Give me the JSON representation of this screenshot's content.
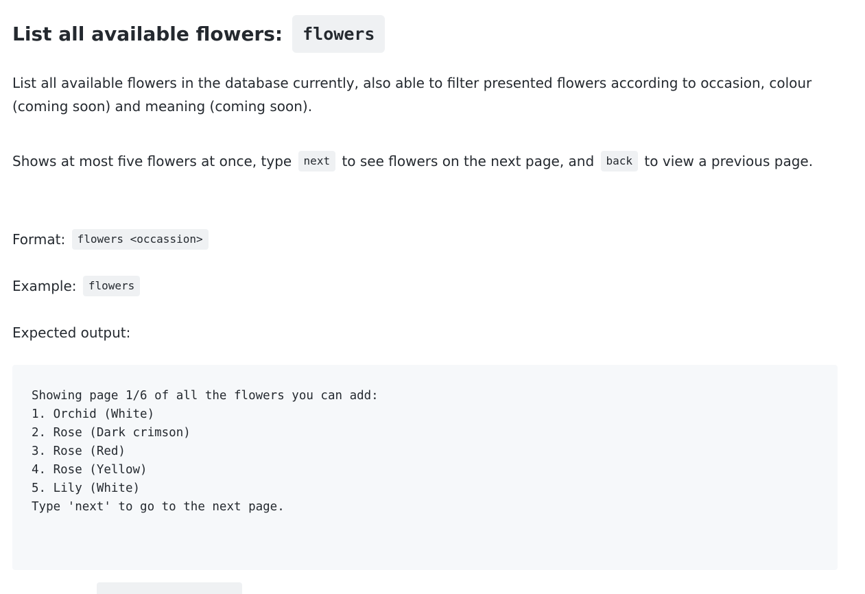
{
  "heading": {
    "text": "List all available flowers:",
    "code": "flowers"
  },
  "description": "List all available flowers in the database currently, also able to filter presented flowers according to occasion, colour (coming soon) and meaning (coming soon).",
  "paging": {
    "before_next": "Shows at most five flowers at once, type",
    "next_code": "next",
    "between": "to see flowers on the next page, and",
    "back_code": "back",
    "after_back": "to view a previous page."
  },
  "format": {
    "label": "Format:",
    "code": "flowers <occassion>"
  },
  "example": {
    "label": "Example:",
    "code": "flowers"
  },
  "expected_output": {
    "label": "Expected output:",
    "lines": [
      "Showing page 1/6 of all the flowers you can add:",
      "1. Orchid (White)",
      "2. Rose (Dark crimson)",
      "3. Rose (Red)",
      "4. Rose (Yellow)",
      "5. Lily (White)",
      "Type 'next' to go to the next page."
    ]
  }
}
